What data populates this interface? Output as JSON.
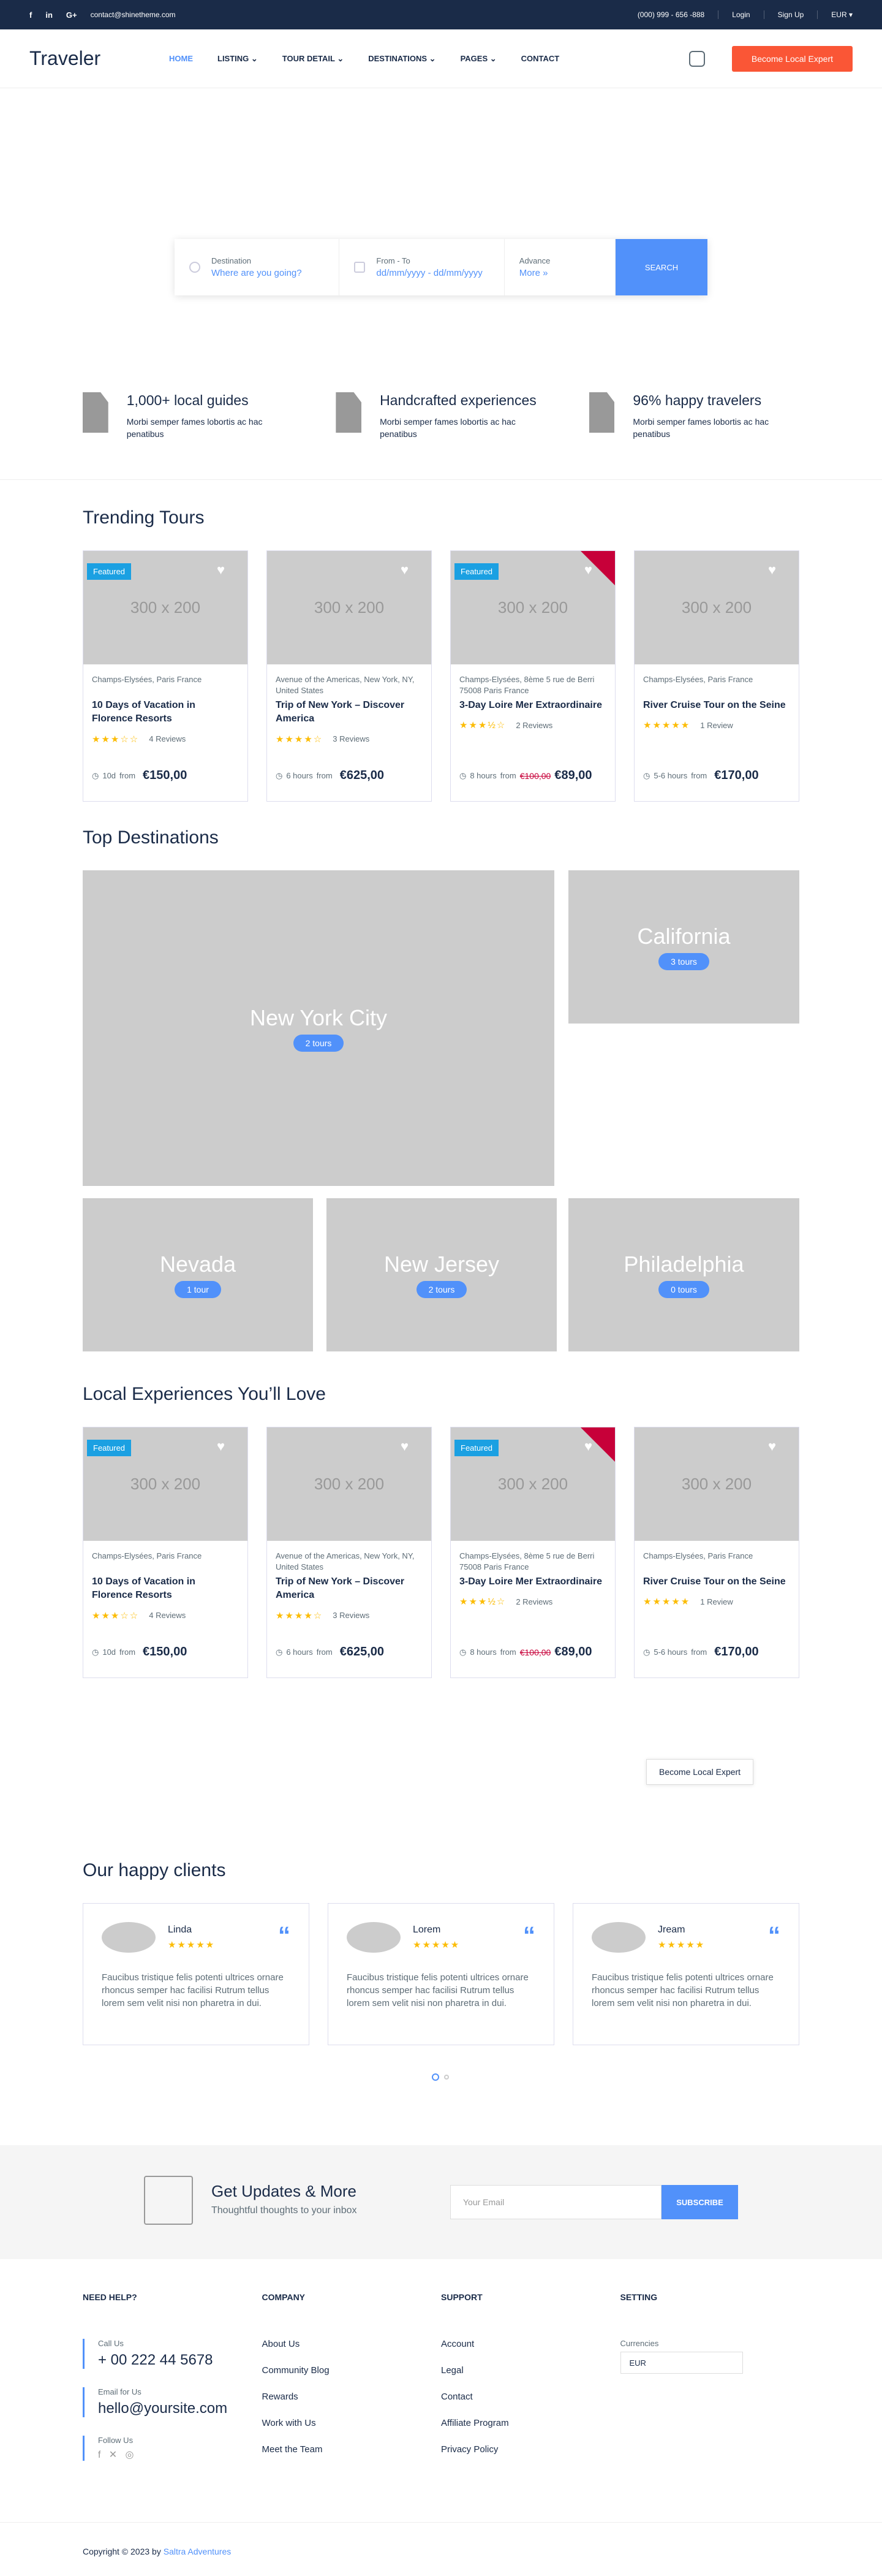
{
  "topbar": {
    "social": [
      "f",
      "in",
      "G+"
    ],
    "email": "contact@shinetheme.com",
    "phone": "(000) 999 - 656 -888",
    "login": "Login",
    "signup": "Sign Up",
    "currency": "EUR ▾"
  },
  "nav": {
    "logo": "Traveler",
    "items": [
      "HOME",
      "LISTING ⌄",
      "TOUR DETAIL ⌄",
      "DESTINATIONS ⌄",
      "PAGES ⌄",
      "CONTACT"
    ],
    "cta": "Become Local Expert"
  },
  "search": {
    "dest_label": "Destination",
    "dest_placeholder": "Where are you going?",
    "date_label": "From - To",
    "date_value": "dd/mm/yyyy - dd/mm/yyyy",
    "adv_label": "Advance",
    "adv_more": "More »",
    "button": "SEARCH"
  },
  "features": [
    {
      "title": "1,000+ local guides",
      "text": "Morbi semper fames lobortis ac hac penatibus"
    },
    {
      "title": "Handcrafted experiences",
      "text": "Morbi semper fames lobortis ac hac penatibus"
    },
    {
      "title": "96% happy travelers",
      "text": "Morbi semper fames lobortis ac hac penatibus"
    }
  ],
  "trending_title": "Trending Tours",
  "tours": [
    {
      "img": "300 x 200",
      "badge": "Featured",
      "loc": "Champs-Elysées, Paris France",
      "title": "10 Days of Vacation in Florence Resorts",
      "stars": "★★★☆☆",
      "reviews": "4 Reviews",
      "dur": "10d",
      "from": "from",
      "old": "",
      "price": "€150,00"
    },
    {
      "img": "300 x 200",
      "badge": "",
      "loc": "Avenue of the Americas, New York, NY, United States",
      "title": "Trip of New York – Discover America",
      "stars": "★★★★☆",
      "reviews": "3 Reviews",
      "dur": "6 hours",
      "from": "from",
      "old": "",
      "price": "€625,00"
    },
    {
      "img": "300 x 200",
      "badge": "Featured",
      "loc": "Champs-Elysées, 8ème 5 rue de Berri 75008 Paris France",
      "title": "3-Day Loire Mer Extraordinaire",
      "stars": "★★★½☆",
      "reviews": "2 Reviews",
      "dur": "8 hours",
      "from": "from",
      "old": "€100,00",
      "price": "€89,00"
    },
    {
      "img": "300 x 200",
      "badge": "",
      "loc": "Champs-Elysées, Paris France",
      "title": "River Cruise Tour on the Seine",
      "stars": "★★★★★",
      "reviews": "1 Review",
      "dur": "5-6 hours",
      "from": "from",
      "old": "",
      "price": "€170,00"
    }
  ],
  "dest_title": "Top Destinations",
  "destinations": [
    {
      "name": "New York City",
      "tours": "2 tours"
    },
    {
      "name": "California",
      "tours": "3 tours"
    },
    {
      "name": "Nevada",
      "tours": "1 tour"
    },
    {
      "name": "New Jersey",
      "tours": "2 tours"
    },
    {
      "name": "Philadelphia",
      "tours": "0 tours"
    }
  ],
  "local_title": "Local Experiences You’ll Love",
  "become": "Become Local Expert",
  "clients_title": "Our happy clients",
  "testimonials": [
    {
      "name": "Linda",
      "text": "Faucibus tristique felis potenti ultrices ornare rhoncus semper hac facilisi Rutrum tellus lorem sem velit nisi non pharetra in dui."
    },
    {
      "name": "Lorem",
      "text": "Faucibus tristique felis potenti ultrices ornare rhoncus semper hac facilisi Rutrum tellus lorem sem velit nisi non pharetra in dui."
    },
    {
      "name": "Jream",
      "text": "Faucibus tristique felis potenti ultrices ornare rhoncus semper hac facilisi Rutrum tellus lorem sem velit nisi non pharetra in dui."
    }
  ],
  "newsletter": {
    "title": "Get Updates & More",
    "sub": "Thoughtful thoughts to your inbox",
    "placeholder": "Your Email",
    "button": "SUBSCRIBE"
  },
  "footer": {
    "help": "NEED HELP?",
    "call_label": "Call Us",
    "call": "+ 00 222 44 5678",
    "email_label": "Email for Us",
    "email": "hello@yoursite.com",
    "follow": "Follow Us",
    "company": "COMPANY",
    "company_links": [
      "About Us",
      "Community Blog",
      "Rewards",
      "Work with Us",
      "Meet the Team"
    ],
    "support": "SUPPORT",
    "support_links": [
      "Account",
      "Legal",
      "Contact",
      "Affiliate Program",
      "Privacy Policy"
    ],
    "setting": "SETTING",
    "currencies": "Currencies",
    "currency": "EUR"
  },
  "copyright": "Copyright © 2023 by ",
  "copyright_link": "Saltra Adventures"
}
